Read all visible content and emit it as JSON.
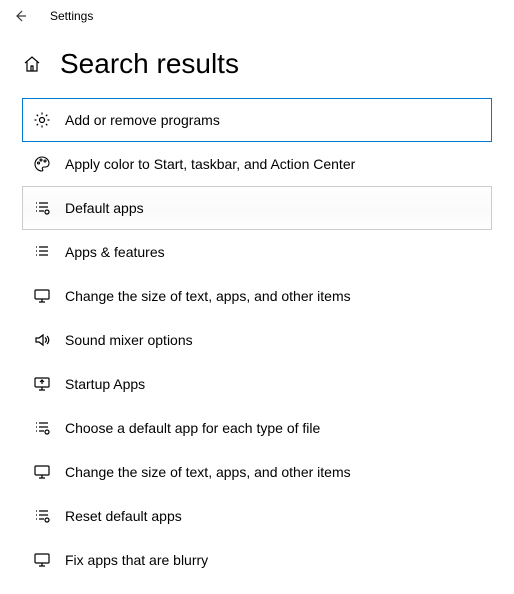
{
  "titlebar": {
    "app_title": "Settings"
  },
  "header": {
    "page_title": "Search results"
  },
  "results": [
    {
      "label": "Add or remove programs",
      "state": "selected"
    },
    {
      "label": "Apply color to Start, taskbar, and Action Center",
      "state": ""
    },
    {
      "label": "Default apps",
      "state": "hover"
    },
    {
      "label": "Apps & features",
      "state": ""
    },
    {
      "label": "Change the size of text, apps, and other items",
      "state": ""
    },
    {
      "label": "Sound mixer options",
      "state": ""
    },
    {
      "label": "Startup Apps",
      "state": ""
    },
    {
      "label": "Choose a default app for each type of file",
      "state": ""
    },
    {
      "label": "Change the size of text, apps, and other items",
      "state": ""
    },
    {
      "label": "Reset default apps",
      "state": ""
    },
    {
      "label": "Fix apps that are blurry",
      "state": ""
    }
  ]
}
